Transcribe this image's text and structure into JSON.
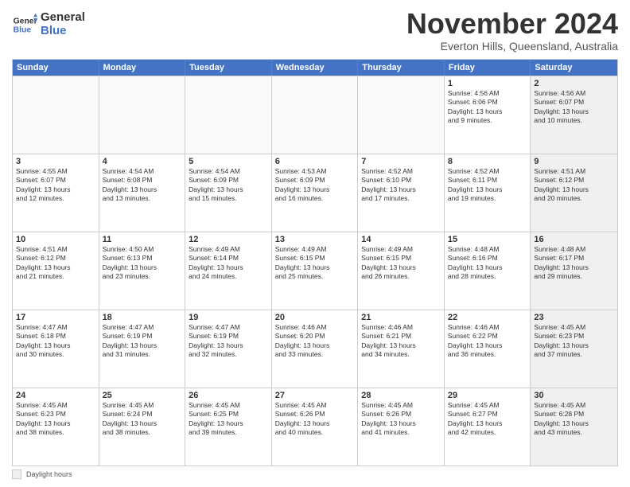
{
  "logo": {
    "line1": "General",
    "line2": "Blue"
  },
  "title": "November 2024",
  "subtitle": "Everton Hills, Queensland, Australia",
  "days_of_week": [
    "Sunday",
    "Monday",
    "Tuesday",
    "Wednesday",
    "Thursday",
    "Friday",
    "Saturday"
  ],
  "legend_label": "Daylight hours",
  "weeks": [
    [
      {
        "day": "",
        "info": "",
        "empty": true
      },
      {
        "day": "",
        "info": "",
        "empty": true
      },
      {
        "day": "",
        "info": "",
        "empty": true
      },
      {
        "day": "",
        "info": "",
        "empty": true
      },
      {
        "day": "",
        "info": "",
        "empty": true
      },
      {
        "day": "1",
        "info": "Sunrise: 4:56 AM\nSunset: 6:06 PM\nDaylight: 13 hours\nand 9 minutes.",
        "empty": false,
        "shaded": false
      },
      {
        "day": "2",
        "info": "Sunrise: 4:56 AM\nSunset: 6:07 PM\nDaylight: 13 hours\nand 10 minutes.",
        "empty": false,
        "shaded": true
      }
    ],
    [
      {
        "day": "3",
        "info": "Sunrise: 4:55 AM\nSunset: 6:07 PM\nDaylight: 13 hours\nand 12 minutes.",
        "empty": false,
        "shaded": false
      },
      {
        "day": "4",
        "info": "Sunrise: 4:54 AM\nSunset: 6:08 PM\nDaylight: 13 hours\nand 13 minutes.",
        "empty": false,
        "shaded": false
      },
      {
        "day": "5",
        "info": "Sunrise: 4:54 AM\nSunset: 6:09 PM\nDaylight: 13 hours\nand 15 minutes.",
        "empty": false,
        "shaded": false
      },
      {
        "day": "6",
        "info": "Sunrise: 4:53 AM\nSunset: 6:09 PM\nDaylight: 13 hours\nand 16 minutes.",
        "empty": false,
        "shaded": false
      },
      {
        "day": "7",
        "info": "Sunrise: 4:52 AM\nSunset: 6:10 PM\nDaylight: 13 hours\nand 17 minutes.",
        "empty": false,
        "shaded": false
      },
      {
        "day": "8",
        "info": "Sunrise: 4:52 AM\nSunset: 6:11 PM\nDaylight: 13 hours\nand 19 minutes.",
        "empty": false,
        "shaded": false
      },
      {
        "day": "9",
        "info": "Sunrise: 4:51 AM\nSunset: 6:12 PM\nDaylight: 13 hours\nand 20 minutes.",
        "empty": false,
        "shaded": true
      }
    ],
    [
      {
        "day": "10",
        "info": "Sunrise: 4:51 AM\nSunset: 6:12 PM\nDaylight: 13 hours\nand 21 minutes.",
        "empty": false,
        "shaded": false
      },
      {
        "day": "11",
        "info": "Sunrise: 4:50 AM\nSunset: 6:13 PM\nDaylight: 13 hours\nand 23 minutes.",
        "empty": false,
        "shaded": false
      },
      {
        "day": "12",
        "info": "Sunrise: 4:49 AM\nSunset: 6:14 PM\nDaylight: 13 hours\nand 24 minutes.",
        "empty": false,
        "shaded": false
      },
      {
        "day": "13",
        "info": "Sunrise: 4:49 AM\nSunset: 6:15 PM\nDaylight: 13 hours\nand 25 minutes.",
        "empty": false,
        "shaded": false
      },
      {
        "day": "14",
        "info": "Sunrise: 4:49 AM\nSunset: 6:15 PM\nDaylight: 13 hours\nand 26 minutes.",
        "empty": false,
        "shaded": false
      },
      {
        "day": "15",
        "info": "Sunrise: 4:48 AM\nSunset: 6:16 PM\nDaylight: 13 hours\nand 28 minutes.",
        "empty": false,
        "shaded": false
      },
      {
        "day": "16",
        "info": "Sunrise: 4:48 AM\nSunset: 6:17 PM\nDaylight: 13 hours\nand 29 minutes.",
        "empty": false,
        "shaded": true
      }
    ],
    [
      {
        "day": "17",
        "info": "Sunrise: 4:47 AM\nSunset: 6:18 PM\nDaylight: 13 hours\nand 30 minutes.",
        "empty": false,
        "shaded": false
      },
      {
        "day": "18",
        "info": "Sunrise: 4:47 AM\nSunset: 6:19 PM\nDaylight: 13 hours\nand 31 minutes.",
        "empty": false,
        "shaded": false
      },
      {
        "day": "19",
        "info": "Sunrise: 4:47 AM\nSunset: 6:19 PM\nDaylight: 13 hours\nand 32 minutes.",
        "empty": false,
        "shaded": false
      },
      {
        "day": "20",
        "info": "Sunrise: 4:46 AM\nSunset: 6:20 PM\nDaylight: 13 hours\nand 33 minutes.",
        "empty": false,
        "shaded": false
      },
      {
        "day": "21",
        "info": "Sunrise: 4:46 AM\nSunset: 6:21 PM\nDaylight: 13 hours\nand 34 minutes.",
        "empty": false,
        "shaded": false
      },
      {
        "day": "22",
        "info": "Sunrise: 4:46 AM\nSunset: 6:22 PM\nDaylight: 13 hours\nand 36 minutes.",
        "empty": false,
        "shaded": false
      },
      {
        "day": "23",
        "info": "Sunrise: 4:45 AM\nSunset: 6:23 PM\nDaylight: 13 hours\nand 37 minutes.",
        "empty": false,
        "shaded": true
      }
    ],
    [
      {
        "day": "24",
        "info": "Sunrise: 4:45 AM\nSunset: 6:23 PM\nDaylight: 13 hours\nand 38 minutes.",
        "empty": false,
        "shaded": false
      },
      {
        "day": "25",
        "info": "Sunrise: 4:45 AM\nSunset: 6:24 PM\nDaylight: 13 hours\nand 38 minutes.",
        "empty": false,
        "shaded": false
      },
      {
        "day": "26",
        "info": "Sunrise: 4:45 AM\nSunset: 6:25 PM\nDaylight: 13 hours\nand 39 minutes.",
        "empty": false,
        "shaded": false
      },
      {
        "day": "27",
        "info": "Sunrise: 4:45 AM\nSunset: 6:26 PM\nDaylight: 13 hours\nand 40 minutes.",
        "empty": false,
        "shaded": false
      },
      {
        "day": "28",
        "info": "Sunrise: 4:45 AM\nSunset: 6:26 PM\nDaylight: 13 hours\nand 41 minutes.",
        "empty": false,
        "shaded": false
      },
      {
        "day": "29",
        "info": "Sunrise: 4:45 AM\nSunset: 6:27 PM\nDaylight: 13 hours\nand 42 minutes.",
        "empty": false,
        "shaded": false
      },
      {
        "day": "30",
        "info": "Sunrise: 4:45 AM\nSunset: 6:28 PM\nDaylight: 13 hours\nand 43 minutes.",
        "empty": false,
        "shaded": true
      }
    ]
  ]
}
